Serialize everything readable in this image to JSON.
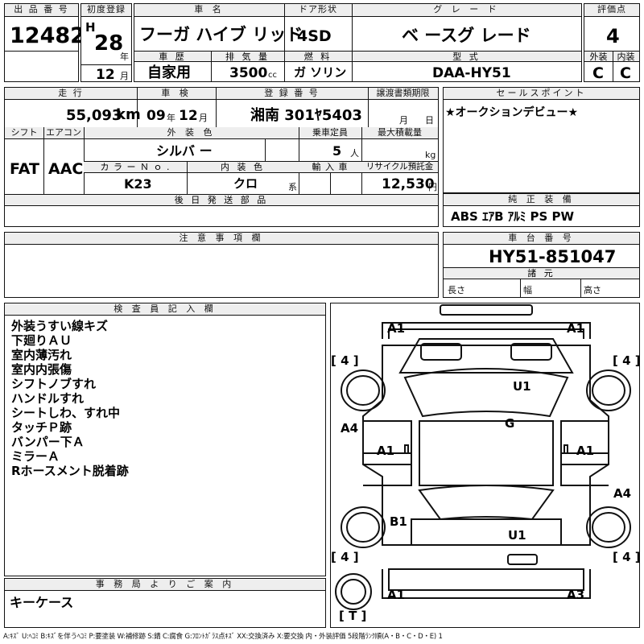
{
  "header": {
    "lot_label": "出 品 番 号",
    "lot_number": "12482",
    "first_reg_label": "初度登録",
    "era": "H",
    "year": "28",
    "year_unit": "年",
    "month": "12",
    "month_unit": "月",
    "car_name_label": "車 名",
    "car_name": "フーガ ハイブ リッド",
    "door_label": "ドア形状",
    "door_value": "4SD",
    "grade_label": "グ レ ー ド",
    "grade_value": "ベ ースグ レード",
    "score_label": "評価点",
    "score_value": "4",
    "history_label": "車 歴",
    "history_value": "自家用",
    "displacement_label": "排 気 量",
    "displacement_value": "3500",
    "displacement_unit": "cc",
    "fuel_label": "燃 料",
    "fuel_value": "ガ ソリン",
    "model_label": "型 式",
    "model_value": "DAA-HY51",
    "exterior_label": "外装",
    "exterior_value": "C",
    "interior_label": "内装",
    "interior_value": "C"
  },
  "details": {
    "mileage_label": "走 行",
    "mileage_value": "55,093",
    "mileage_unit": "km",
    "inspection_label": "車 検",
    "inspection_year": "09",
    "inspection_year_unit": "年",
    "inspection_month": "12",
    "inspection_month_unit": "月",
    "plate_label": "登 録 番 号",
    "plate_value": "湘南 301ﾔ5403",
    "transfer_label": "譲渡書類期限",
    "transfer_month_unit": "月",
    "transfer_day_unit": "日",
    "shift_label": "シフト",
    "shift_value": "FAT",
    "aircon_label": "エアコン",
    "aircon_value": "AAC",
    "color_label": "外 装 色",
    "color_value": "シルバ ー",
    "capacity_label": "乗車定員",
    "capacity_value": "5",
    "capacity_unit": "人",
    "load_label": "最大積載量",
    "load_unit": "kg",
    "color_no_label": "カ ラ ー Ｎ ｏ .",
    "color_no_value": "K23",
    "interior_color_label": "内 装 色",
    "interior_color_value": "クロ",
    "interior_color_unit": "系",
    "import_label": "輸 入 車",
    "recycle_label": "リサイクル預託金",
    "recycle_value": "12,530",
    "recycle_unit": "円",
    "later_parts_label": "後 日 発 送 部 品"
  },
  "sales": {
    "label": "セールスポイント",
    "text": "★オークションデビュー★"
  },
  "equipment": {
    "label": "純 正 装 備",
    "text": "ABS ｴｱB ｱﾙﾐ PS PW"
  },
  "caution": {
    "label": "注 意 事 項 欄"
  },
  "chassis": {
    "label": "車 台 番 号",
    "value": "HY51-851047",
    "spec_label": "諸 元",
    "length_label": "長さ",
    "width_label": "幅",
    "height_label": "高さ"
  },
  "inspector": {
    "label": "検 査 員 記 入 欄",
    "notes": [
      "外装うすい線キズ",
      "下廻りＡＵ",
      "室内薄汚れ",
      "室内内張傷",
      "シフトノブすれ",
      "ハンドルすれ",
      "シートしわ、すれ中",
      "タッチＰ跡",
      "バンパー下Ａ",
      "ミラーＡ",
      "Rホースメント脱着跡"
    ]
  },
  "office": {
    "label": "事 務 局 よ り ご 案 内",
    "text": "キーケース"
  },
  "diagram": {
    "marks": [
      {
        "id": "front-left-bumper",
        "text": "A1"
      },
      {
        "id": "front-right-bumper",
        "text": "A1"
      },
      {
        "id": "tire-front-left",
        "text": "[ 4 ]"
      },
      {
        "id": "tire-front-right",
        "text": "[ 4 ]"
      },
      {
        "id": "roof",
        "text": "U1"
      },
      {
        "id": "windshield",
        "text": "G"
      },
      {
        "id": "left-fender",
        "text": "A4"
      },
      {
        "id": "left-door",
        "text": "A1"
      },
      {
        "id": "right-door",
        "text": "A1"
      },
      {
        "id": "right-quarter",
        "text": "A4"
      },
      {
        "id": "left-rear-door",
        "text": "B1"
      },
      {
        "id": "trunk",
        "text": "U1"
      },
      {
        "id": "tire-rear-left",
        "text": "[ 4 ]"
      },
      {
        "id": "tire-rear-right",
        "text": "[ 4 ]"
      },
      {
        "id": "rear-left-bumper",
        "text": "A1"
      },
      {
        "id": "rear-right-bumper",
        "text": "A3"
      },
      {
        "id": "spare-tire",
        "text": "[ T ]"
      }
    ]
  },
  "legend": "A:ｷｽﾞ U:ﾍｺﾐ B:ｷｽﾞを伴うﾍｺﾐ P:要塗装 W:補修跡 S:錆 C:腐食 G:ﾌﾛﾝﾄｶﾞﾗｽ点ｷｽﾞ XX:交換済み X:要交換 内・外装評価 5段階ﾗﾝｸ順(A・B・C・D・E) 1",
  "colors": {
    "header_bg": "#eeeeee",
    "border": "#111111",
    "text": "#000000"
  }
}
